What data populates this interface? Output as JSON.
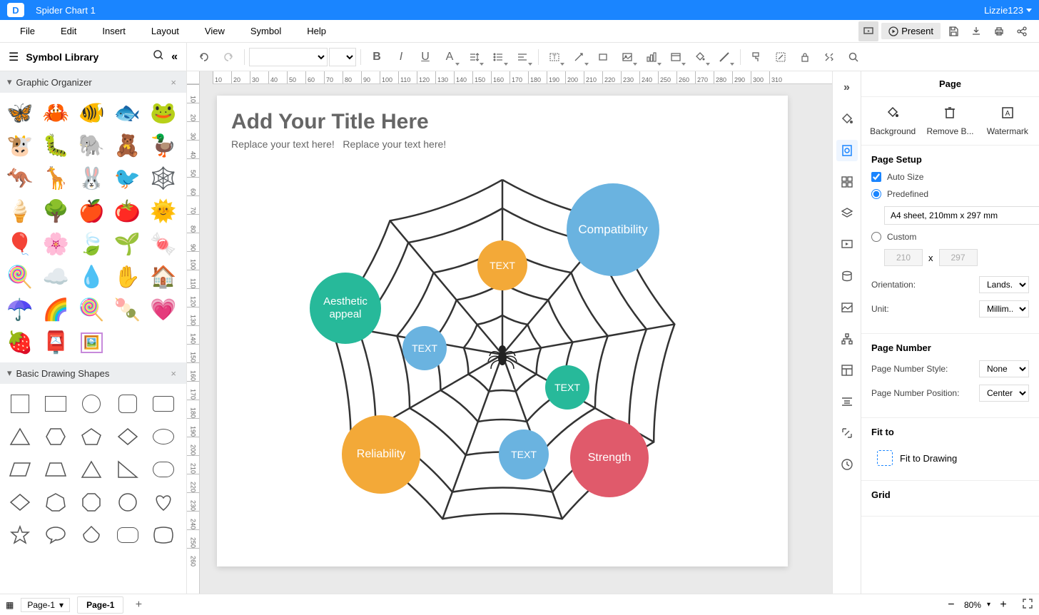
{
  "titlebar": {
    "doc_title": "Spider Chart 1",
    "user": "Lizzie123"
  },
  "menubar": {
    "items": [
      "File",
      "Edit",
      "Insert",
      "Layout",
      "View",
      "Symbol",
      "Help"
    ],
    "present": "Present"
  },
  "symbol_library": {
    "title": "Symbol Library"
  },
  "categories": {
    "graphic_organizer": "Graphic Organizer",
    "basic_shapes": "Basic Drawing Shapes"
  },
  "page": {
    "title": "Add Your Title Here",
    "sub1": "Replace your text here!",
    "sub2": "Replace your text here!"
  },
  "bubbles": {
    "compatibility": "Compatibility",
    "aesthetic": "Aesthetic appeal",
    "reliability": "Reliability",
    "strength": "Strength",
    "text": "TEXT"
  },
  "right_panel": {
    "title": "Page",
    "actions": {
      "background": "Background",
      "remove": "Remove B...",
      "watermark": "Watermark"
    },
    "page_setup": "Page Setup",
    "auto_size": "Auto Size",
    "predefined": "Predefined",
    "preset": "A4 sheet, 210mm x 297 mm",
    "custom": "Custom",
    "width": "210",
    "height": "297",
    "x": "x",
    "orientation": "Orientation:",
    "orientation_val": "Lands...",
    "unit": "Unit:",
    "unit_val": "Millim...",
    "page_number": "Page Number",
    "pn_style": "Page Number Style:",
    "pn_style_val": "None",
    "pn_pos": "Page Number Position:",
    "pn_pos_val": "Center",
    "fit_to": "Fit to",
    "fit_drawing": "Fit to Drawing",
    "grid": "Grid"
  },
  "statusbar": {
    "page_sel": "Page-1",
    "tab": "Page-1",
    "zoom": "80%"
  },
  "ruler_h": [
    10,
    20,
    30,
    40,
    50,
    60,
    70,
    80,
    90,
    100,
    110,
    120,
    130,
    140,
    150,
    160,
    170,
    180,
    190,
    200,
    210,
    220,
    230,
    240,
    250,
    260,
    270,
    280,
    290,
    300,
    310
  ],
  "ruler_v": [
    10,
    20,
    30,
    40,
    50,
    60,
    70,
    80,
    90,
    100,
    110,
    120,
    130,
    140,
    150,
    160,
    170,
    180,
    190,
    200,
    210,
    220,
    230,
    240,
    250,
    260
  ]
}
